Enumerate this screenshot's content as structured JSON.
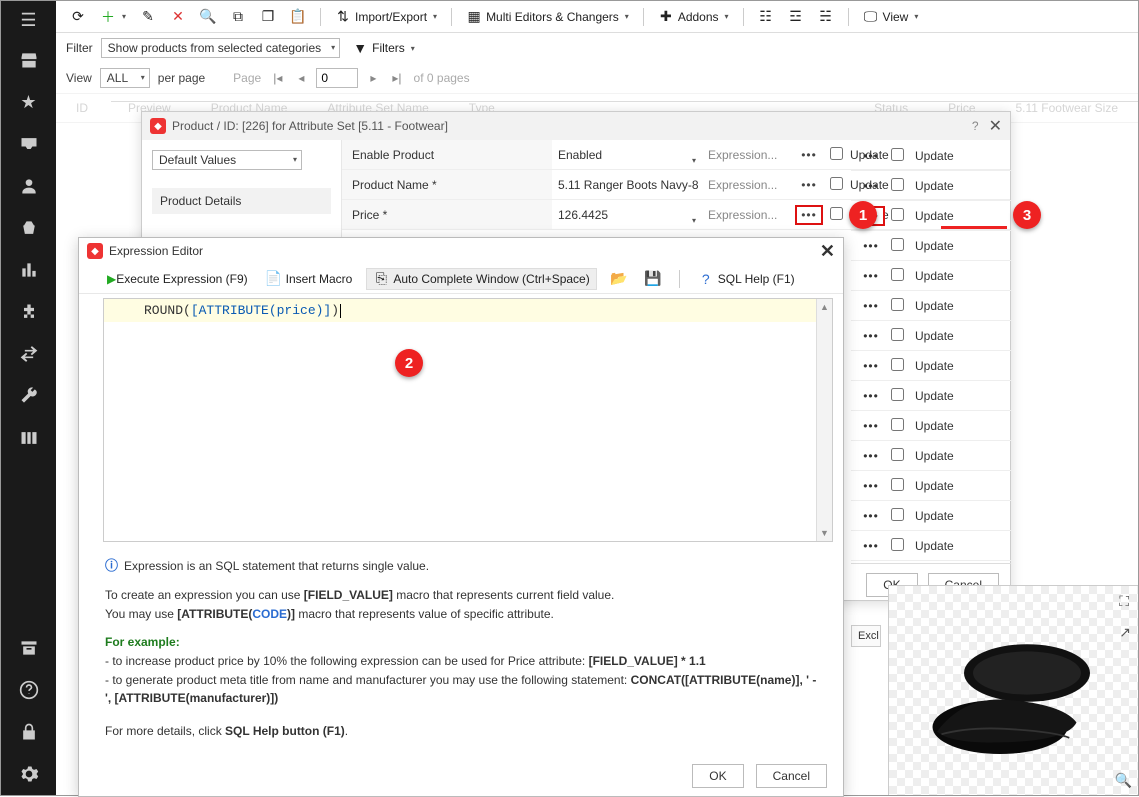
{
  "sidebar": {
    "icons": [
      "menu",
      "store",
      "star",
      "inbox",
      "person",
      "basket",
      "chart",
      "puzzle",
      "swap",
      "wrench",
      "columns"
    ],
    "bottom": [
      "archive",
      "help",
      "lock",
      "gear"
    ]
  },
  "toolbar": {
    "importExport": "Import/Export",
    "multiEditors": "Multi Editors & Changers",
    "addons": "Addons",
    "view": "View"
  },
  "filter": {
    "label": "Filter",
    "selectValue": "Show products from selected categories",
    "filtersLabel": "Filters"
  },
  "pager": {
    "viewLabel": "View",
    "perPageValue": "ALL",
    "perPageLabel": "per page",
    "pageLabel": "Page",
    "pageValue": "0",
    "ofPages": "of 0 pages"
  },
  "gridHeaders": [
    "ID",
    "Preview",
    "Product Name",
    "Attribute Set Name",
    "Type",
    "Status",
    "Price",
    "5.11 Footwear Size"
  ],
  "productWindow": {
    "title": "Product / ID: [226] for Attribute Set [5.11 - Footwear]",
    "scopeSelect": "Default Values",
    "leftSection": "Product Details",
    "rows": [
      {
        "label": "Enable Product",
        "value": "Enabled",
        "hasCaret": true
      },
      {
        "label": "Product Name *",
        "value": "5.11 Ranger Boots Navy-8",
        "hasCaret": false
      },
      {
        "label": "Price *",
        "value": "126.4425",
        "hasCaret": true
      }
    ],
    "expressionPlaceholder": "Expression...",
    "updateLabel": "Update",
    "ok": "OK",
    "cancel": "Cancel"
  },
  "updateColumn": {
    "count": 14,
    "label": "Update"
  },
  "exprEditor": {
    "title": "Expression Editor",
    "execute": "Execute Expression (F9)",
    "insertMacro": "Insert Macro",
    "autoComplete": "Auto Complete Window (Ctrl+Space)",
    "sqlHelp": "SQL Help (F1)",
    "expression_prefix": "ROUND(",
    "expression_macro": "[ATTRIBUTE(price)]",
    "expression_suffix": ")",
    "info1": "Expression is an SQL statement that returns single value.",
    "info2a": "To create an expression you can use ",
    "info2b": "[FIELD_VALUE]",
    "info2c": " macro that represents current field value.",
    "info3a": "You may use ",
    "info3b": "[ATTRIBUTE(",
    "info3c": "CODE",
    "info3d": ")]",
    "info3e": " macro that represents value of specific attribute.",
    "example": "For example:",
    "ex1a": "   - to increase product price by 10% the following expression can be used for Price attribute: ",
    "ex1b": "[FIELD_VALUE] * 1.1",
    "ex2a": "   - to generate product meta title from name and manufacturer you may use the following statement: ",
    "ex2b": "CONCAT([ATTRIBUTE(name)], ' - ', [ATTRIBUTE(manufacturer)])",
    "more1": "For more details, click ",
    "more2": "SQL Help button (F1)",
    "more3": ".",
    "ok": "OK",
    "cancel": "Cancel"
  },
  "badges": {
    "b1": "1",
    "b2": "2",
    "b3": "3"
  },
  "excludeTab": "Excl"
}
